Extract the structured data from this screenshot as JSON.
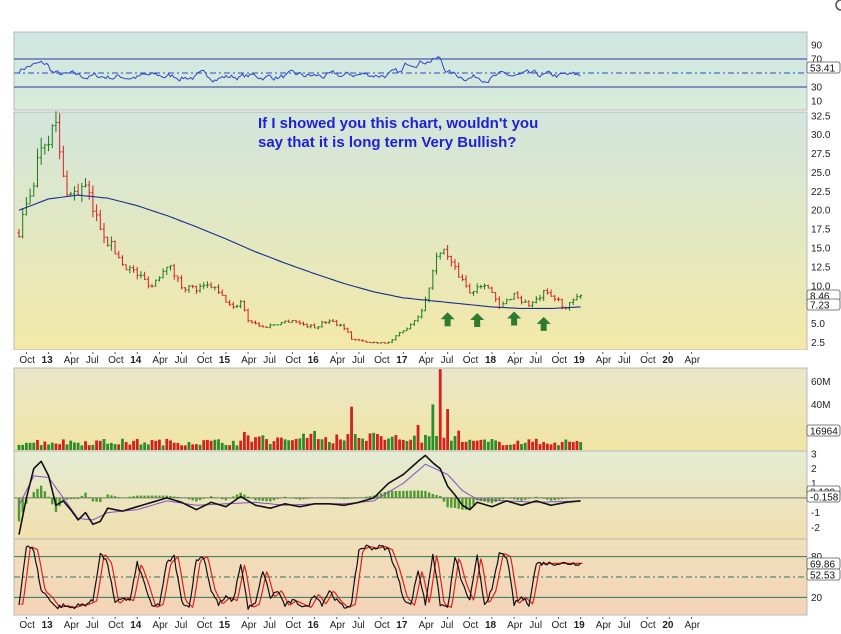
{
  "chart_data": [
    {
      "type": "line",
      "panel": "rsi",
      "ylim": [
        0,
        100
      ],
      "yticks": [
        90,
        70,
        30,
        10
      ],
      "levels": [
        70,
        50,
        30
      ],
      "last_value_label": "53.41",
      "colors": {
        "line": "#3046c8",
        "overbought_fill": "#4a8bd6",
        "band_top": "#cfe6e4",
        "band_bottom": "#d8ecd9"
      }
    },
    {
      "type": "line",
      "panel": "price",
      "ylim": [
        1.5,
        33
      ],
      "yticks": [
        "32.5",
        "30.0",
        "27.5",
        "25.0",
        "22.5",
        "20.0",
        "17.5",
        "15.0",
        "12.5",
        "10.0",
        "7.5",
        "5.0",
        "2.5"
      ],
      "annotation": [
        "If I showed you this chart,  wouldn't you",
        "say that it is long term Very Bullish?"
      ],
      "price_points": [
        [
          0,
          17
        ],
        [
          2,
          24
        ],
        [
          3,
          29
        ],
        [
          5,
          31
        ],
        [
          6,
          24
        ],
        [
          7,
          22
        ],
        [
          9,
          23
        ],
        [
          10,
          20
        ],
        [
          12,
          16
        ],
        [
          14,
          13
        ],
        [
          16,
          11.5
        ],
        [
          18,
          10
        ],
        [
          20,
          13
        ],
        [
          22,
          10
        ],
        [
          24,
          9.5
        ],
        [
          26,
          10
        ],
        [
          27,
          9
        ],
        [
          29,
          7
        ],
        [
          30,
          8
        ],
        [
          31,
          5.5
        ],
        [
          32,
          5
        ],
        [
          33,
          4.5
        ],
        [
          35,
          5
        ],
        [
          37,
          5.5
        ],
        [
          38,
          5
        ],
        [
          40,
          4.5
        ],
        [
          42,
          5.5
        ],
        [
          44,
          4.5
        ],
        [
          45,
          3
        ],
        [
          47,
          2.5
        ],
        [
          48,
          2.5
        ],
        [
          50,
          2.5
        ],
        [
          52,
          4
        ],
        [
          54,
          6
        ],
        [
          55,
          8
        ],
        [
          56,
          12
        ],
        [
          57,
          15
        ],
        [
          58,
          14
        ],
        [
          59,
          12
        ],
        [
          60,
          11
        ],
        [
          61,
          9
        ],
        [
          62,
          10
        ],
        [
          63,
          10.5
        ],
        [
          64,
          9
        ],
        [
          65,
          7
        ],
        [
          66,
          8
        ],
        [
          67,
          9
        ],
        [
          68,
          8
        ],
        [
          69,
          7.5
        ],
        [
          70,
          8
        ],
        [
          71,
          9
        ],
        [
          72,
          8.5
        ],
        [
          73,
          8
        ],
        [
          74,
          7
        ],
        [
          75,
          8
        ],
        [
          76,
          8.5
        ]
      ],
      "ma_points": [
        [
          0,
          20
        ],
        [
          4,
          21.5
        ],
        [
          8,
          22
        ],
        [
          12,
          21.6
        ],
        [
          16,
          20.6
        ],
        [
          20,
          19.3
        ],
        [
          24,
          17.8
        ],
        [
          28,
          16.2
        ],
        [
          32,
          14.5
        ],
        [
          36,
          13
        ],
        [
          40,
          11.6
        ],
        [
          44,
          10.3
        ],
        [
          48,
          9.2
        ],
        [
          52,
          8.4
        ],
        [
          56,
          8
        ],
        [
          60,
          7.6
        ],
        [
          64,
          7.2
        ],
        [
          68,
          7
        ],
        [
          72,
          7
        ],
        [
          76,
          7.2
        ]
      ],
      "last_value_labels": [
        "8.46",
        "7.23"
      ],
      "arrows_at": [
        [
          58,
          5.3
        ],
        [
          62,
          5.2
        ],
        [
          67,
          5.4
        ],
        [
          71,
          4.7
        ]
      ],
      "colors": {
        "up": "#1d7a1d",
        "down": "#d42020",
        "ma": "#1a2e8c",
        "arrow": "#2e7a2e",
        "band_top": "#d2e6dc",
        "band_bottom": "#f3e9a8"
      }
    },
    {
      "type": "bar",
      "panel": "volume",
      "yticks": [
        "60M",
        "40M"
      ],
      "last_value_label": "16964",
      "spike_months": [
        [
          45,
          38
        ],
        [
          54,
          22
        ],
        [
          56,
          40
        ],
        [
          57,
          71
        ],
        [
          58,
          36
        ]
      ],
      "colors": {
        "up": "#2a8c2a",
        "down": "#d42020",
        "band_top": "#e9e6c9",
        "band_bottom": "#f1e5a4"
      }
    },
    {
      "type": "line",
      "panel": "macd",
      "ylim": [
        -2.8,
        3.2
      ],
      "yticks": [
        "3",
        "2",
        "1",
        "-1",
        "-2"
      ],
      "zero_label": "0.120",
      "last_value_label": "-0.158",
      "macd_points": [
        [
          0,
          -2.5
        ],
        [
          1,
          0
        ],
        [
          2,
          2
        ],
        [
          3,
          2.5
        ],
        [
          4,
          1.5
        ],
        [
          5,
          -0.5
        ],
        [
          6,
          -0.2
        ],
        [
          7,
          -0.8
        ],
        [
          8,
          -1.5
        ],
        [
          9,
          -1
        ],
        [
          10,
          -1.8
        ],
        [
          11,
          -1.6
        ],
        [
          12,
          -0.7
        ],
        [
          14,
          -0.9
        ],
        [
          16,
          -0.6
        ],
        [
          18,
          -0.3
        ],
        [
          20,
          0
        ],
        [
          22,
          -0.3
        ],
        [
          24,
          -0.8
        ],
        [
          26,
          -0.3
        ],
        [
          28,
          -0.6
        ],
        [
          30,
          0.1
        ],
        [
          32,
          -0.5
        ],
        [
          34,
          -0.7
        ],
        [
          36,
          -0.4
        ],
        [
          38,
          -0.6
        ],
        [
          40,
          -0.4
        ],
        [
          42,
          -0.4
        ],
        [
          44,
          -0.5
        ],
        [
          46,
          -0.3
        ],
        [
          48,
          0
        ],
        [
          50,
          1
        ],
        [
          52,
          1.6
        ],
        [
          54,
          2.5
        ],
        [
          55,
          2.9
        ],
        [
          56,
          2.4
        ],
        [
          57,
          2
        ],
        [
          58,
          0.8
        ],
        [
          59,
          0.2
        ],
        [
          60,
          -0.5
        ],
        [
          61,
          -0.8
        ],
        [
          62,
          -0.3
        ],
        [
          64,
          -0.6
        ],
        [
          66,
          -0.2
        ],
        [
          68,
          -0.5
        ],
        [
          70,
          -0.2
        ],
        [
          72,
          -0.5
        ],
        [
          74,
          -0.3
        ],
        [
          76,
          -0.2
        ]
      ],
      "signal_points": [
        [
          0,
          -0.5
        ],
        [
          2,
          1.5
        ],
        [
          4,
          1.4
        ],
        [
          6,
          0
        ],
        [
          8,
          -1.4
        ],
        [
          10,
          -1.5
        ],
        [
          12,
          -1
        ],
        [
          16,
          -0.8
        ],
        [
          20,
          -0.2
        ],
        [
          24,
          -0.5
        ],
        [
          28,
          -0.4
        ],
        [
          32,
          -0.3
        ],
        [
          36,
          -0.5
        ],
        [
          40,
          -0.4
        ],
        [
          44,
          -0.4
        ],
        [
          48,
          -0.2
        ],
        [
          52,
          1
        ],
        [
          55,
          2.3
        ],
        [
          58,
          1.6
        ],
        [
          60,
          0.5
        ],
        [
          62,
          -0.1
        ],
        [
          66,
          -0.2
        ],
        [
          70,
          -0.3
        ],
        [
          76,
          -0.2
        ]
      ],
      "colors": {
        "macd": "#111111",
        "signal": "#8050c8",
        "hist": "#4f9a30",
        "band_top": "#e3ecd3",
        "band_bottom": "#f2dfae"
      }
    },
    {
      "type": "line",
      "panel": "stochastic",
      "ylim": [
        0,
        100
      ],
      "yticks": [
        "80",
        "20"
      ],
      "levels": [
        80,
        50,
        20
      ],
      "last_value_labels": [
        "69.86",
        "52.53"
      ],
      "stoch_points": [
        [
          0,
          10
        ],
        [
          1,
          95
        ],
        [
          2,
          90
        ],
        [
          3,
          30
        ],
        [
          4,
          20
        ],
        [
          5,
          5
        ],
        [
          6,
          8
        ],
        [
          7,
          5
        ],
        [
          8,
          8
        ],
        [
          9,
          10
        ],
        [
          10,
          15
        ],
        [
          11,
          85
        ],
        [
          12,
          70
        ],
        [
          13,
          10
        ],
        [
          14,
          20
        ],
        [
          15,
          15
        ],
        [
          16,
          70
        ],
        [
          17,
          40
        ],
        [
          18,
          5
        ],
        [
          19,
          10
        ],
        [
          20,
          70
        ],
        [
          21,
          80
        ],
        [
          22,
          15
        ],
        [
          23,
          5
        ],
        [
          24,
          75
        ],
        [
          25,
          80
        ],
        [
          26,
          30
        ],
        [
          27,
          10
        ],
        [
          28,
          20
        ],
        [
          29,
          15
        ],
        [
          30,
          70
        ],
        [
          31,
          5
        ],
        [
          32,
          10
        ],
        [
          33,
          60
        ],
        [
          34,
          20
        ],
        [
          35,
          30
        ],
        [
          36,
          8
        ],
        [
          37,
          15
        ],
        [
          38,
          10
        ],
        [
          39,
          5
        ],
        [
          40,
          25
        ],
        [
          41,
          10
        ],
        [
          42,
          30
        ],
        [
          43,
          15
        ],
        [
          44,
          5
        ],
        [
          45,
          10
        ],
        [
          46,
          90
        ],
        [
          47,
          95
        ],
        [
          48,
          92
        ],
        [
          49,
          95
        ],
        [
          50,
          90
        ],
        [
          51,
          60
        ],
        [
          52,
          20
        ],
        [
          53,
          8
        ],
        [
          54,
          60
        ],
        [
          55,
          10
        ],
        [
          56,
          85
        ],
        [
          57,
          10
        ],
        [
          58,
          5
        ],
        [
          59,
          80
        ],
        [
          60,
          40
        ],
        [
          61,
          15
        ],
        [
          62,
          80
        ],
        [
          63,
          10
        ],
        [
          64,
          30
        ],
        [
          65,
          85
        ],
        [
          66,
          80
        ],
        [
          67,
          10
        ],
        [
          68,
          20
        ],
        [
          69,
          10
        ],
        [
          70,
          70
        ]
      ],
      "colors": {
        "k": "#111111",
        "d": "#e02020",
        "band_top": "#f0e0bb",
        "band_bottom": "#f4d3b8"
      }
    }
  ],
  "x_axis": {
    "labels": [
      "Oct",
      "13",
      "Apr",
      "Jul",
      "Oct",
      "14",
      "Apr",
      "Jul",
      "Oct",
      "15",
      "Apr",
      "Jul",
      "Oct",
      "16",
      "Apr",
      "Jul",
      "Oct",
      "17",
      "Apr",
      "Jul",
      "Oct",
      "18",
      "Apr",
      "Jul",
      "Oct",
      "19",
      "Apr",
      "Jul",
      "Oct",
      "20",
      "Apr"
    ],
    "year_labels": [
      "13",
      "14",
      "15",
      "16",
      "17",
      "18",
      "19",
      "20"
    ],
    "last_data_month": 76
  },
  "icons": {
    "corner": "circle-icon"
  }
}
